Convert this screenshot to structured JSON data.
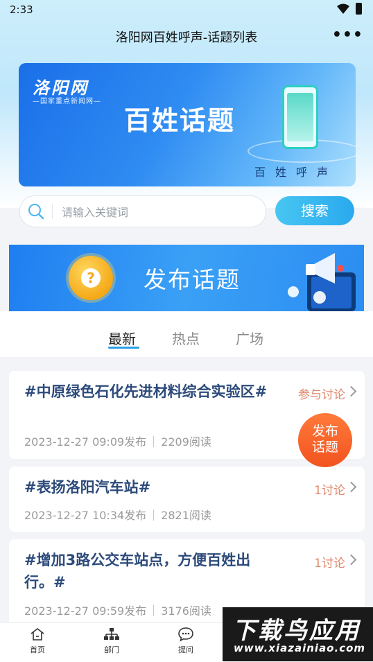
{
  "status": {
    "time": "2:33"
  },
  "header": {
    "title": "洛阳网百姓呼声-话题列表",
    "more": "•••"
  },
  "banner": {
    "logo": "洛阳网",
    "logo_sub": "—国家重点新闻网—",
    "title": "百姓话题",
    "tagline": "百姓呼声"
  },
  "search": {
    "placeholder": "请输入关键词",
    "value": "",
    "button": "搜索"
  },
  "publish_banner": {
    "label": "发布话题"
  },
  "tabs": [
    {
      "label": "最新",
      "active": true
    },
    {
      "label": "热点",
      "active": false
    },
    {
      "label": "广场",
      "active": false
    }
  ],
  "topics": [
    {
      "title": "#中原绿色石化先进材料综合实验区#",
      "date": "2023-12-27 09:09发布",
      "reads": "2209阅读",
      "action": "参与讨论"
    },
    {
      "title": "#表扬洛阳汽车站#",
      "date": "2023-12-27 10:34发布",
      "reads": "2821阅读",
      "action": "1讨论"
    },
    {
      "title": "#增加3路公交车站点，方便百姓出行。#",
      "date": "2023-12-27 09:59发布",
      "reads": "3176阅读",
      "action": "1讨论"
    }
  ],
  "fab": {
    "line1": "发布",
    "line2": "话题"
  },
  "bottom_nav": [
    {
      "label": "首页",
      "icon": "home-icon"
    },
    {
      "label": "部门",
      "icon": "org-chart-icon"
    },
    {
      "label": "提问",
      "icon": "chat-icon"
    }
  ],
  "watermark": {
    "line1": "下载鸟应用",
    "line2": "www.xiazainiao.com"
  },
  "colors": {
    "accent": "#2a9fe8",
    "title_text": "#2c4a7a",
    "action_text": "#e0876a",
    "fab": "#f2531f"
  }
}
